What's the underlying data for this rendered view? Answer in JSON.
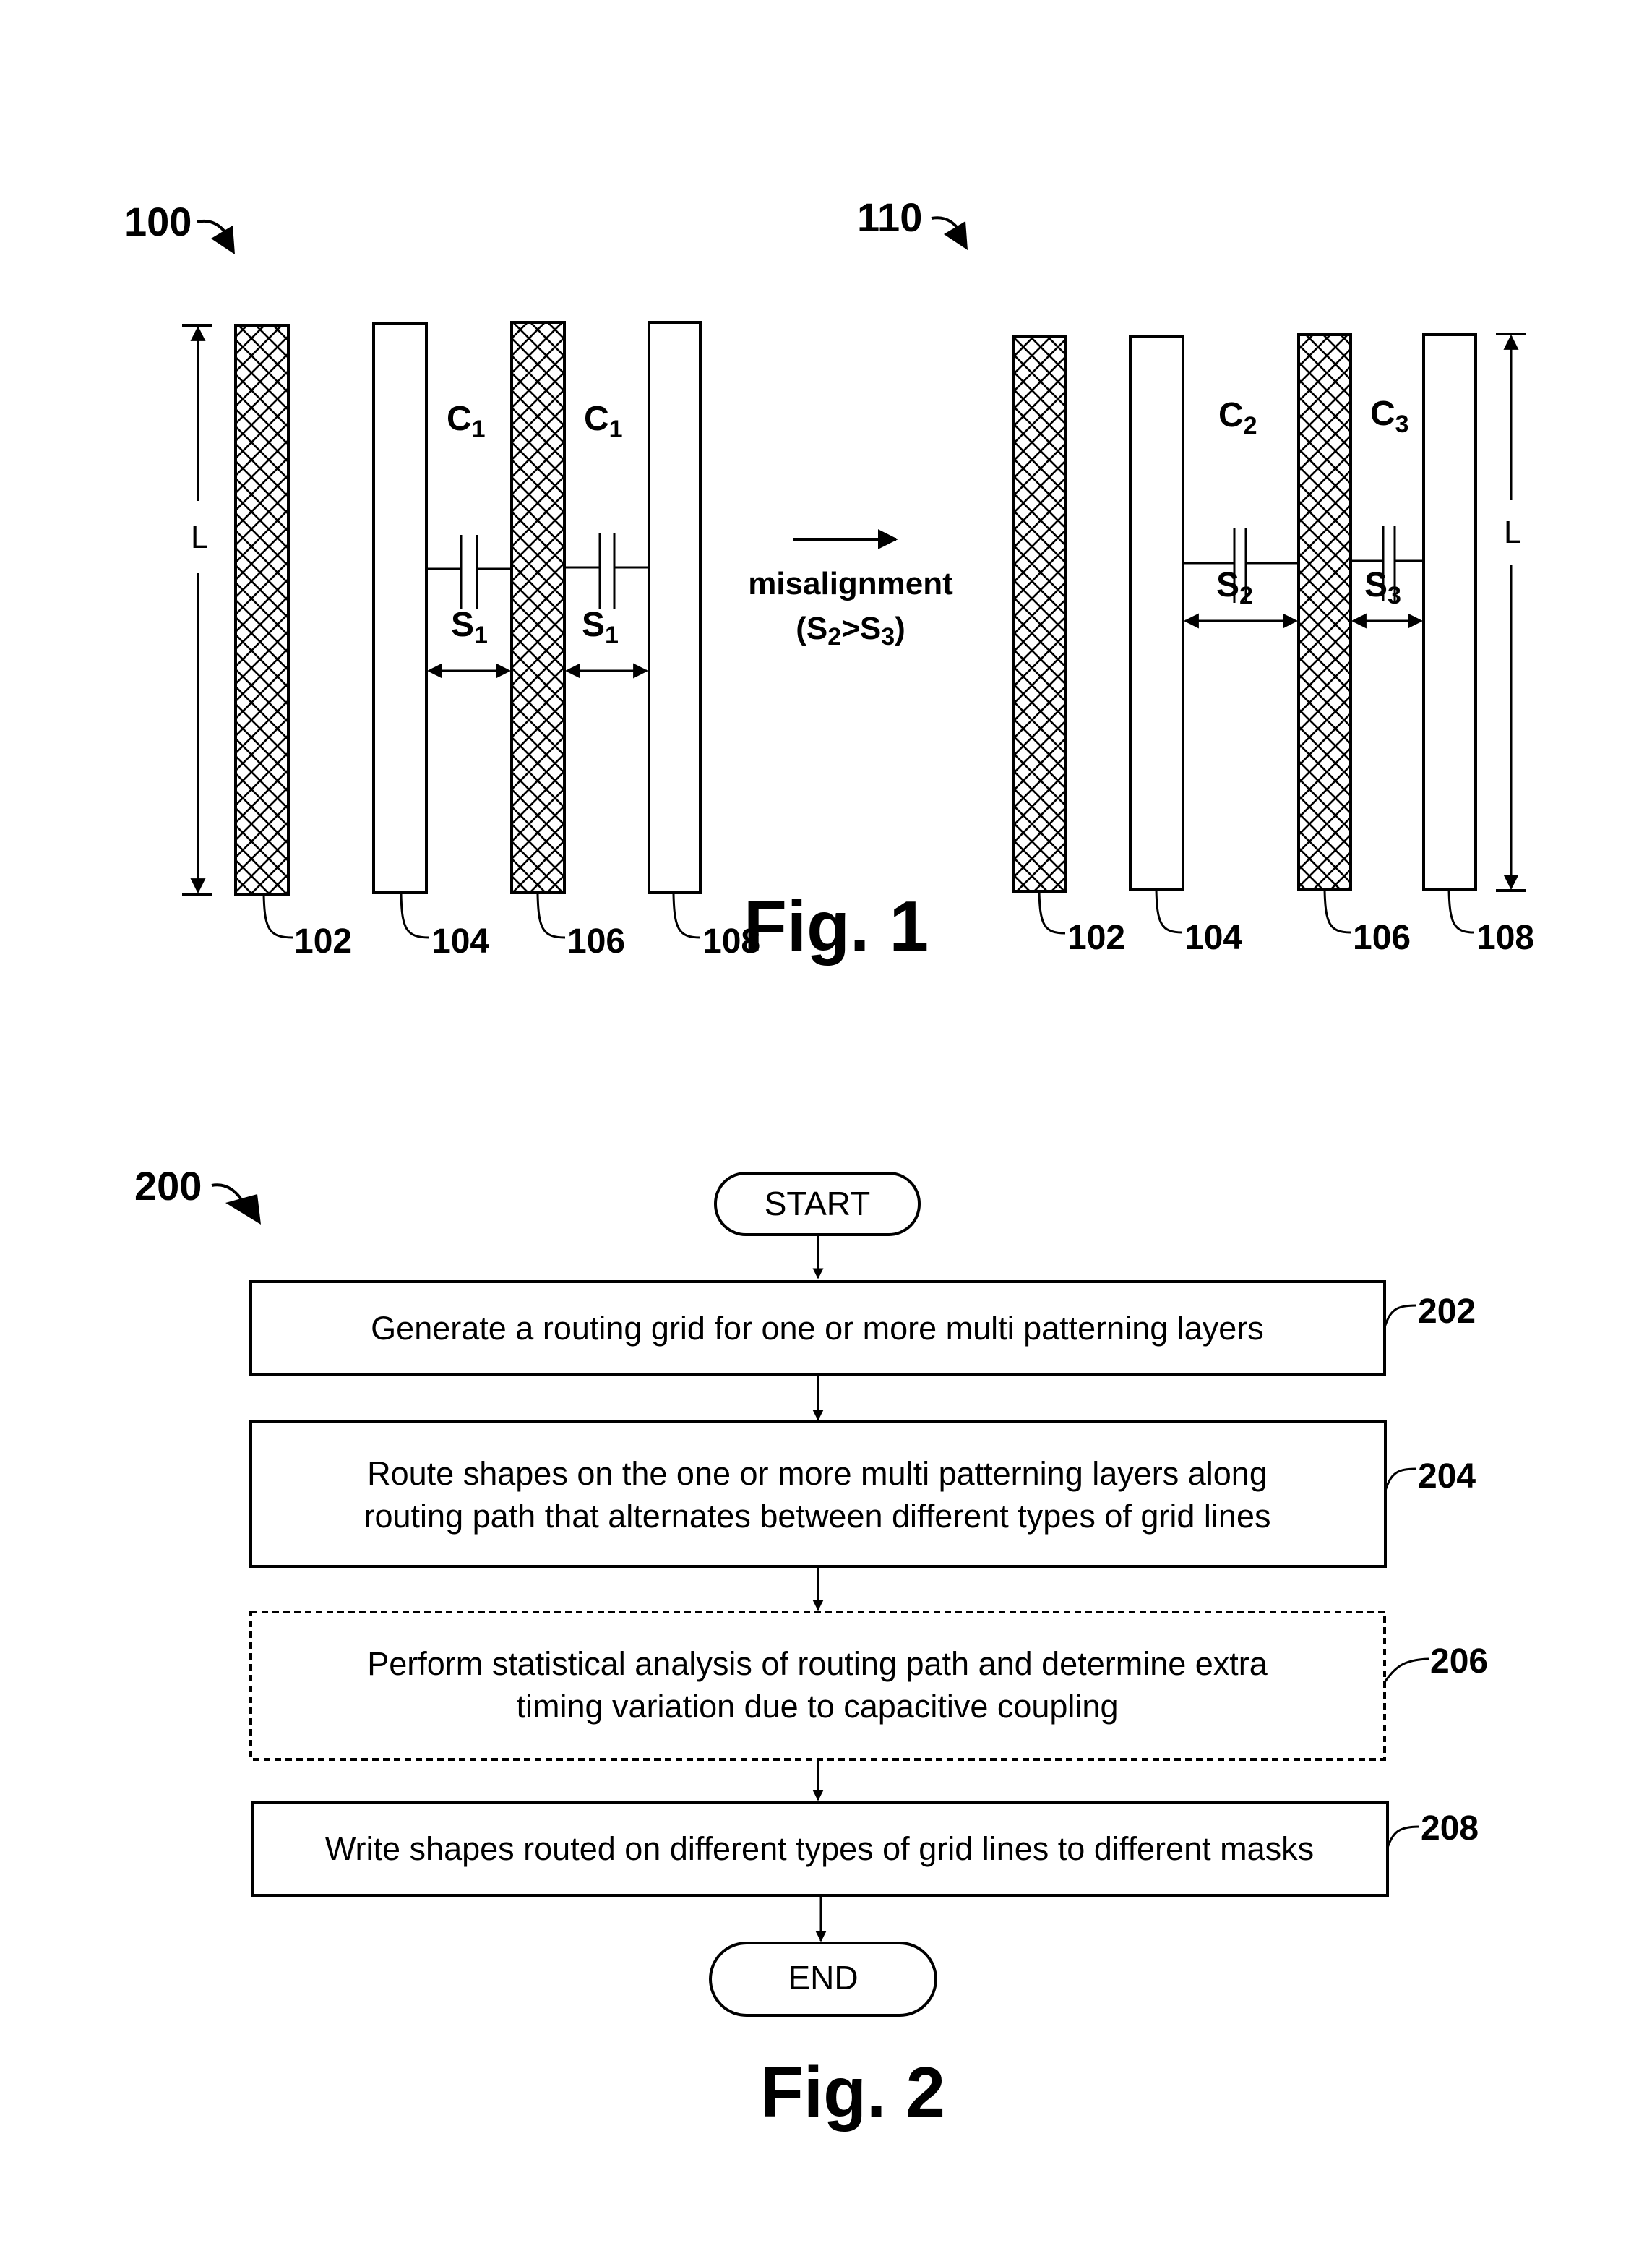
{
  "figure1": {
    "ref_left": "100",
    "ref_right": "110",
    "length_label": "L",
    "transition_label": "misalignment",
    "transition_condition": {
      "open": "(S",
      "sub_a": "2",
      "op": ">S",
      "sub_b": "3",
      "close": ")"
    },
    "left": {
      "caps": [
        {
          "base": "C",
          "sub": "1"
        },
        {
          "base": "C",
          "sub": "1"
        }
      ],
      "spacings": [
        {
          "base": "S",
          "sub": "1"
        },
        {
          "base": "S",
          "sub": "1"
        }
      ],
      "line_labels": [
        "102",
        "104",
        "106",
        "108"
      ],
      "line_patterns": [
        "hatched",
        "plain",
        "hatched",
        "plain"
      ]
    },
    "right": {
      "caps": [
        {
          "base": "C",
          "sub": "2"
        },
        {
          "base": "C",
          "sub": "3"
        }
      ],
      "spacings": [
        {
          "base": "S",
          "sub": "2"
        },
        {
          "base": "S",
          "sub": "3"
        }
      ],
      "line_labels": [
        "102",
        "104",
        "106",
        "108"
      ],
      "line_patterns": [
        "hatched",
        "plain",
        "hatched",
        "plain"
      ]
    },
    "caption": "Fig. 1"
  },
  "figure2": {
    "ref": "200",
    "start": "START",
    "end": "END",
    "steps": [
      {
        "ref": "202",
        "style": "solid",
        "lines": [
          "Generate a routing grid for one or more multi patterning layers"
        ]
      },
      {
        "ref": "204",
        "style": "solid",
        "lines": [
          "Route shapes on the one or more multi patterning layers along",
          "routing path that alternates between different types of grid lines"
        ]
      },
      {
        "ref": "206",
        "style": "dashed",
        "lines": [
          "Perform statistical analysis of routing path and determine extra",
          "timing variation due to capacitive coupling"
        ]
      },
      {
        "ref": "208",
        "style": "solid",
        "lines": [
          "Write shapes routed on different types of grid lines to different masks"
        ]
      }
    ],
    "caption": "Fig. 2"
  }
}
